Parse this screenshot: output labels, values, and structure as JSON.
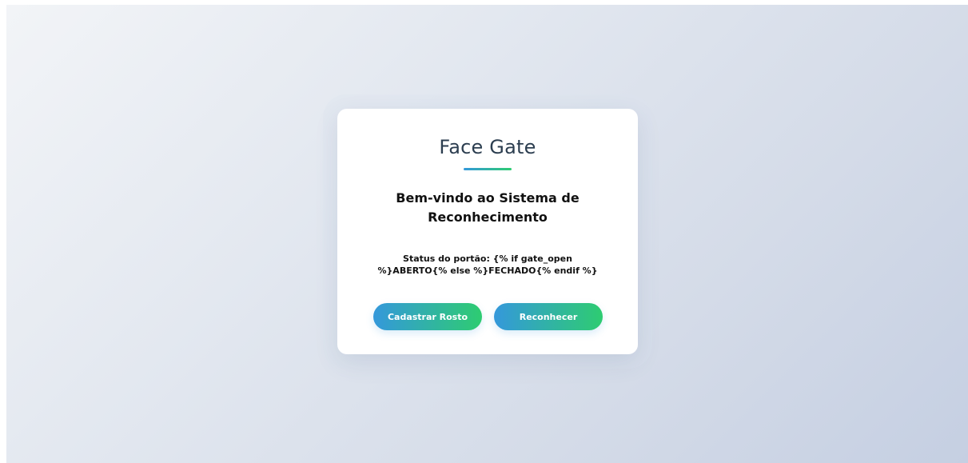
{
  "app": {
    "title": "Face Gate",
    "welcome": "Bem-vindo ao Sistema de Reconhecimento",
    "status_text": "Status do portão: {% if gate_open %}ABERTO{% else %}FECHADO{% endif %}"
  },
  "actions": {
    "register_label": "Cadastrar Rosto",
    "recognize_label": "Reconhecer"
  },
  "colors": {
    "accent_start": "#3498db",
    "accent_end": "#2ecc71",
    "title": "#2c3e50"
  }
}
